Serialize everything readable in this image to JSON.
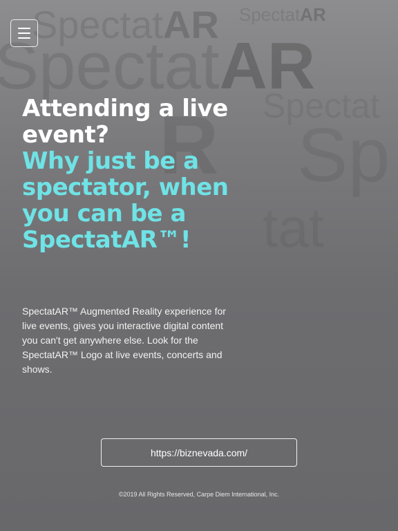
{
  "menu": {
    "icon": "hamburger-menu-icon"
  },
  "headline": {
    "line_white": "Attending a live event?",
    "line_cyan": "Why just be a spectator, when you can be a SpectatAR™!"
  },
  "description": "SpectatAR™ Augmented Reality experience for live events, gives you interactive digital content you can't get anywhere else. Look for the SpectatAR™ Logo at live events, concerts and shows.",
  "cta": {
    "url_label": "https://biznevada.com/"
  },
  "footer": {
    "copyright": "©2019 All Rights Reserved, Carpe Diem International, Inc."
  },
  "colors": {
    "accent_cyan": "#6fe3e6",
    "text_white": "#ffffff",
    "background_gray": "#6d6d70"
  }
}
